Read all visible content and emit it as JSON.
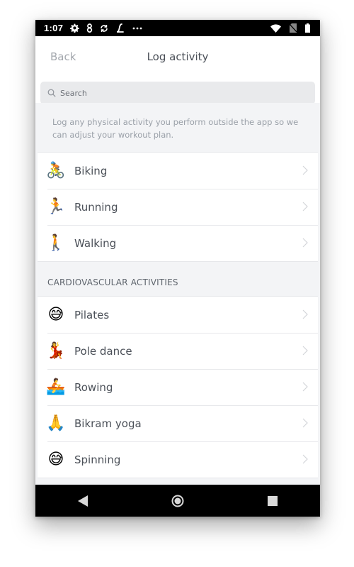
{
  "status_bar": {
    "time": "1:07",
    "icons_left": [
      "gear-icon",
      "eight-icon",
      "sync-icon",
      "l-logo-icon",
      "more-icon"
    ],
    "icons_right": [
      "wifi-icon",
      "no-sim-icon",
      "battery-icon"
    ]
  },
  "header": {
    "back_label": "Back",
    "title": "Log activity"
  },
  "search": {
    "placeholder": "Search"
  },
  "info_text": "Log any physical activity you perform outside the app so we can adjust your workout plan.",
  "primary_activities": [
    {
      "label": "Biking",
      "emoji": "🚴",
      "icon": "biking-icon"
    },
    {
      "label": "Running",
      "emoji": "🏃",
      "icon": "running-icon"
    },
    {
      "label": "Walking",
      "emoji": "🚶",
      "icon": "walking-icon"
    }
  ],
  "section_header": "CARDIOVASCULAR ACTIVITIES",
  "cardio_activities": [
    {
      "label": "Pilates",
      "emoji": "😅",
      "icon": "sweat-smile-icon"
    },
    {
      "label": "Pole dance",
      "emoji": "💃",
      "icon": "dancer-icon"
    },
    {
      "label": "Rowing",
      "emoji": "🚣",
      "icon": "rowing-icon"
    },
    {
      "label": "Bikram yoga",
      "emoji": "🙏",
      "icon": "praying-hands-icon"
    },
    {
      "label": "Spinning",
      "emoji": "😅",
      "icon": "sweat-smile-icon"
    }
  ],
  "nav": [
    "back-triangle-icon",
    "home-circle-icon",
    "recents-square-icon"
  ]
}
